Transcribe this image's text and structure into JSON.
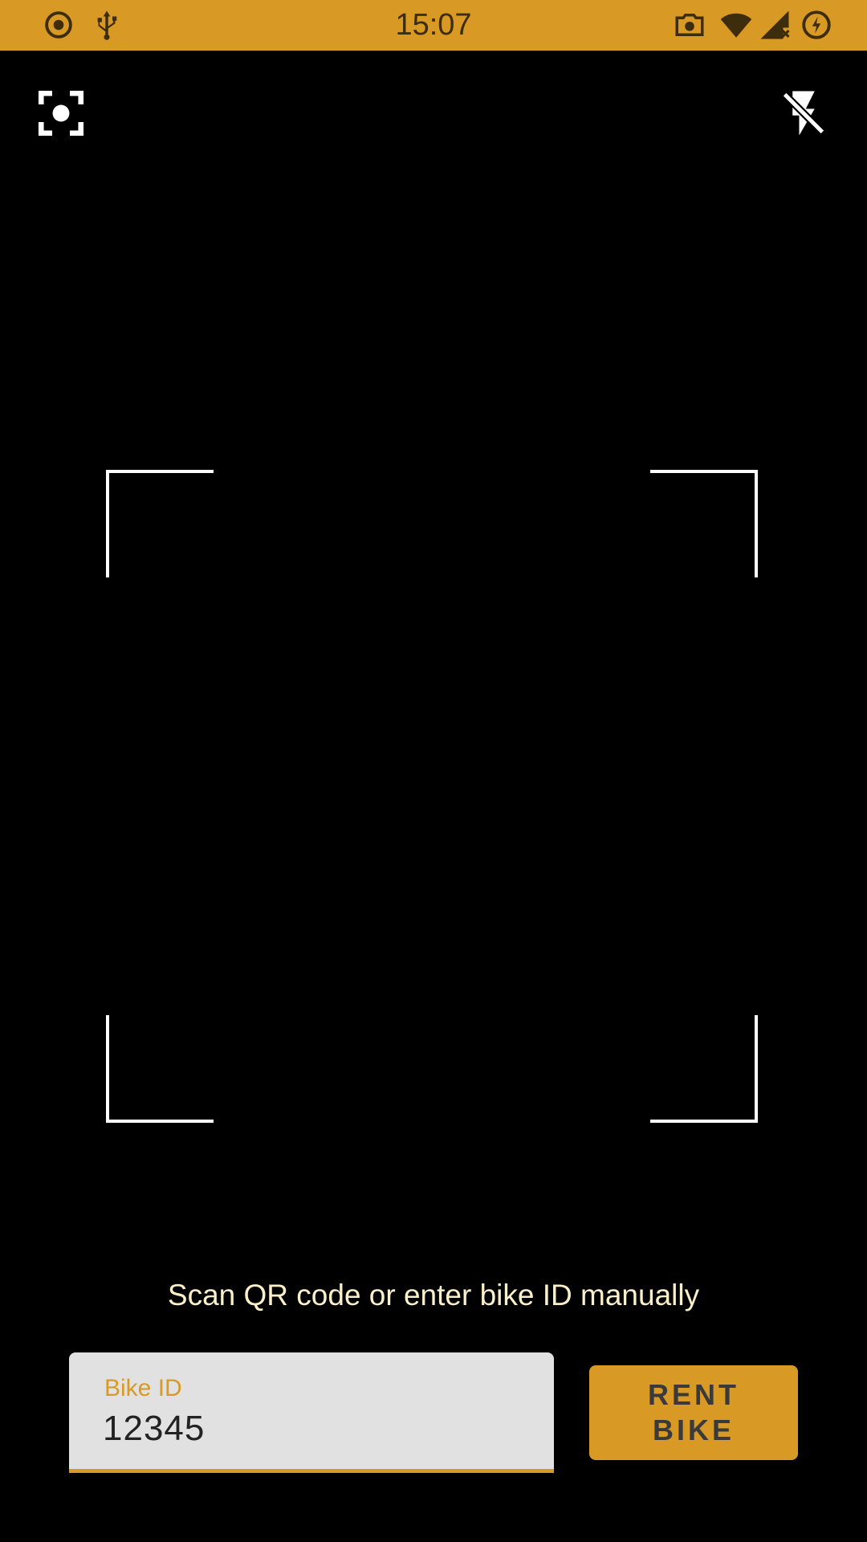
{
  "status_bar": {
    "time": "15:07",
    "left_icons": [
      "record-icon",
      "usb-icon"
    ],
    "right_icons": [
      "camera-icon",
      "wifi-icon",
      "cellular-no-signal-icon",
      "data-saver-icon"
    ],
    "background_color": "#d89a24"
  },
  "camera_controls": {
    "focus_icon": "focus-center-icon",
    "flash_icon": "flash-off-icon"
  },
  "scanner": {
    "hint": "Scan QR code or enter bike ID manually"
  },
  "form": {
    "bike_id_label": "Bike ID",
    "bike_id_value": "12345",
    "rent_button_label": "RENT\nBIKE"
  },
  "colors": {
    "accent": "#d89a24",
    "background": "#000000",
    "hint_text": "#fbefc8",
    "field_background": "#e1e1e1"
  }
}
